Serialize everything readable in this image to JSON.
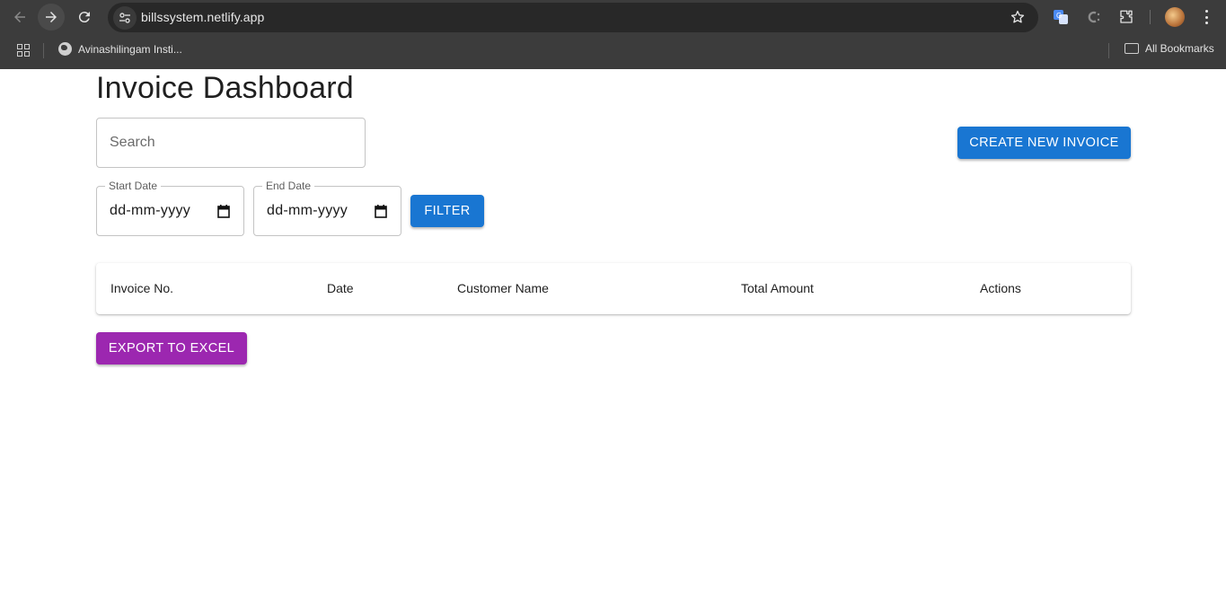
{
  "browser": {
    "url": "billssystem.netlify.app",
    "bookmarks": [
      {
        "label": "Avinashilingam Insti..."
      }
    ],
    "all_bookmarks_label": "All Bookmarks"
  },
  "page": {
    "title": "Invoice Dashboard",
    "search": {
      "placeholder": "Search",
      "value": ""
    },
    "create_button": "CREATE NEW INVOICE",
    "start_date": {
      "label": "Start Date",
      "value": "dd-mm-yyyy"
    },
    "end_date": {
      "label": "End Date",
      "value": "dd-mm-yyyy"
    },
    "filter_button": "FILTER",
    "table": {
      "columns": [
        "Invoice No.",
        "Date",
        "Customer Name",
        "Total Amount",
        "Actions"
      ],
      "rows": []
    },
    "export_button": "EXPORT TO EXCEL"
  },
  "colors": {
    "primary": "#1976d2",
    "secondary": "#9c27b0",
    "chrome_bg": "#3c3c3c"
  }
}
